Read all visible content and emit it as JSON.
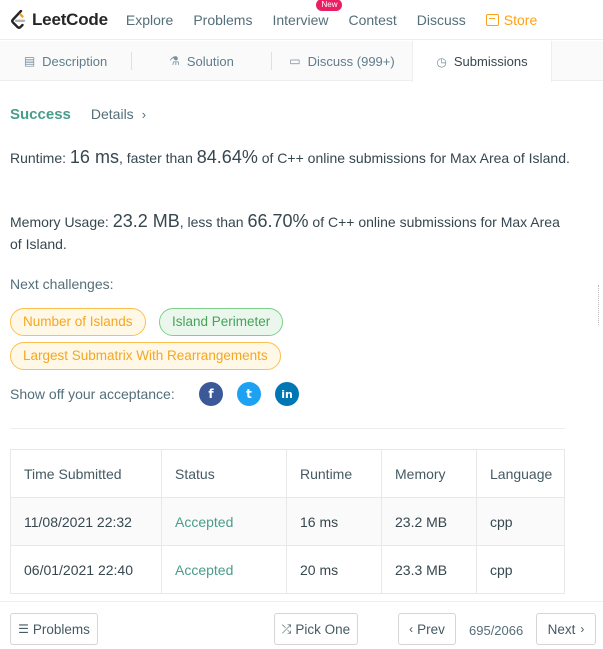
{
  "navbar": {
    "logo_text": "LeetCode",
    "items": [
      "Explore",
      "Problems",
      "Interview",
      "Contest",
      "Discuss"
    ],
    "new_badge": "New",
    "store_label": "Store",
    "accent": "#ffa116"
  },
  "tabs": {
    "description": "Description",
    "solution": "Solution",
    "discuss": "Discuss (999+)",
    "submissions": "Submissions"
  },
  "result": {
    "status": "Success",
    "details": "Details",
    "runtime_label": "Runtime:",
    "runtime_value": "16 ms",
    "runtime_mid": ", faster than",
    "runtime_percent": "84.64%",
    "runtime_tail": "of C++ online submissions for Max Area of Island.",
    "memory_label": "Memory Usage:",
    "memory_value": "23.2 MB",
    "memory_mid": ", less than",
    "memory_percent": "66.70%",
    "memory_tail": "of C++ online submissions for Max Area of Island.",
    "next_label": "Next challenges:",
    "challenges": [
      {
        "label": "Number of Islands",
        "difficulty": "medium"
      },
      {
        "label": "Island Perimeter",
        "difficulty": "easy"
      },
      {
        "label": "Largest Submatrix With Rearrangements",
        "difficulty": "medium"
      }
    ],
    "share_label": "Show off your acceptance:",
    "social_icons": [
      "facebook-icon",
      "twitter-icon",
      "linkedin-icon"
    ]
  },
  "table": {
    "headers": [
      "Time Submitted",
      "Status",
      "Runtime",
      "Memory",
      "Language"
    ],
    "rows": [
      [
        "11/08/2021 22:32",
        "Accepted",
        "16 ms",
        "23.2 MB",
        "cpp"
      ],
      [
        "06/01/2021 22:40",
        "Accepted",
        "20 ms",
        "23.3 MB",
        "cpp"
      ]
    ]
  },
  "bottom": {
    "problems": "Problems",
    "pick_one": "Pick One",
    "prev": "Prev",
    "page": "695/2066",
    "next": "Next"
  }
}
